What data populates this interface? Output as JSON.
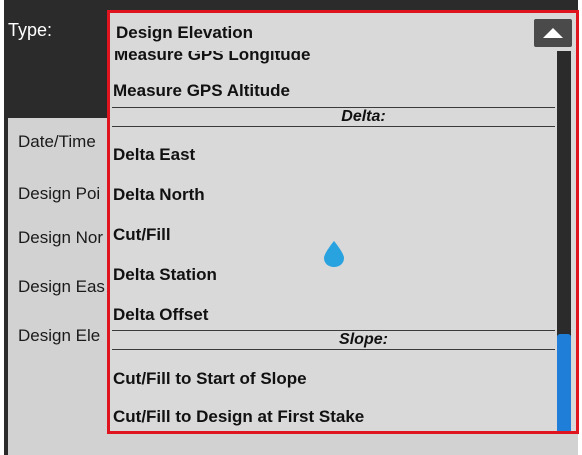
{
  "form": {
    "type_label": "Type:",
    "fields": [
      "Date/Time",
      "Design Poi",
      "Design Nor",
      "Design Eas",
      "Design Ele"
    ]
  },
  "dropdown": {
    "selected": "Design Elevation",
    "cut_item": "Measure GPS Longitude",
    "items_top": [
      "Measure GPS Altitude"
    ],
    "section_delta": "Delta:",
    "delta_items": [
      "Delta East",
      "Delta North",
      "Cut/Fill",
      "Delta Station",
      "Delta Offset"
    ],
    "section_slope": "Slope:",
    "slope_items": [
      "Cut/Fill to Start of Slope",
      "Cut/Fill to Design at First Stake"
    ]
  },
  "icons": {
    "expand": "chevron-up-icon",
    "touch": "water-drop-icon"
  },
  "colors": {
    "highlight_border": "#e0141e",
    "scroll_thumb": "#1e7ed8",
    "touch_indicator": "#29a3e0"
  }
}
